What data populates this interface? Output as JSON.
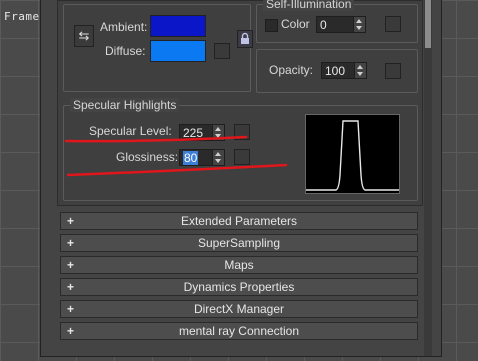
{
  "viewport": {
    "label": "Frame"
  },
  "basic": {
    "ambient_label": "Ambient:",
    "diffuse_label": "Diffuse:",
    "ambient_color": "#0a16c8",
    "diffuse_color": "#0b79f2"
  },
  "self_illumination": {
    "title": "Self-Illumination",
    "color_label": "Color",
    "color_value": "0"
  },
  "opacity": {
    "label": "Opacity:",
    "value": "100"
  },
  "specular": {
    "title": "Specular Highlights",
    "level_label": "Specular Level:",
    "level_value": "225",
    "gloss_label": "Glossiness:",
    "gloss_value": "80"
  },
  "rollouts": [
    "Extended Parameters",
    "SuperSampling",
    "Maps",
    "Dynamics Properties",
    "DirectX Manager",
    "mental ray Connection"
  ],
  "icons": {
    "swap": "swap-arrows-icon",
    "lock": "lock-icon",
    "expand": "plus-icon"
  }
}
